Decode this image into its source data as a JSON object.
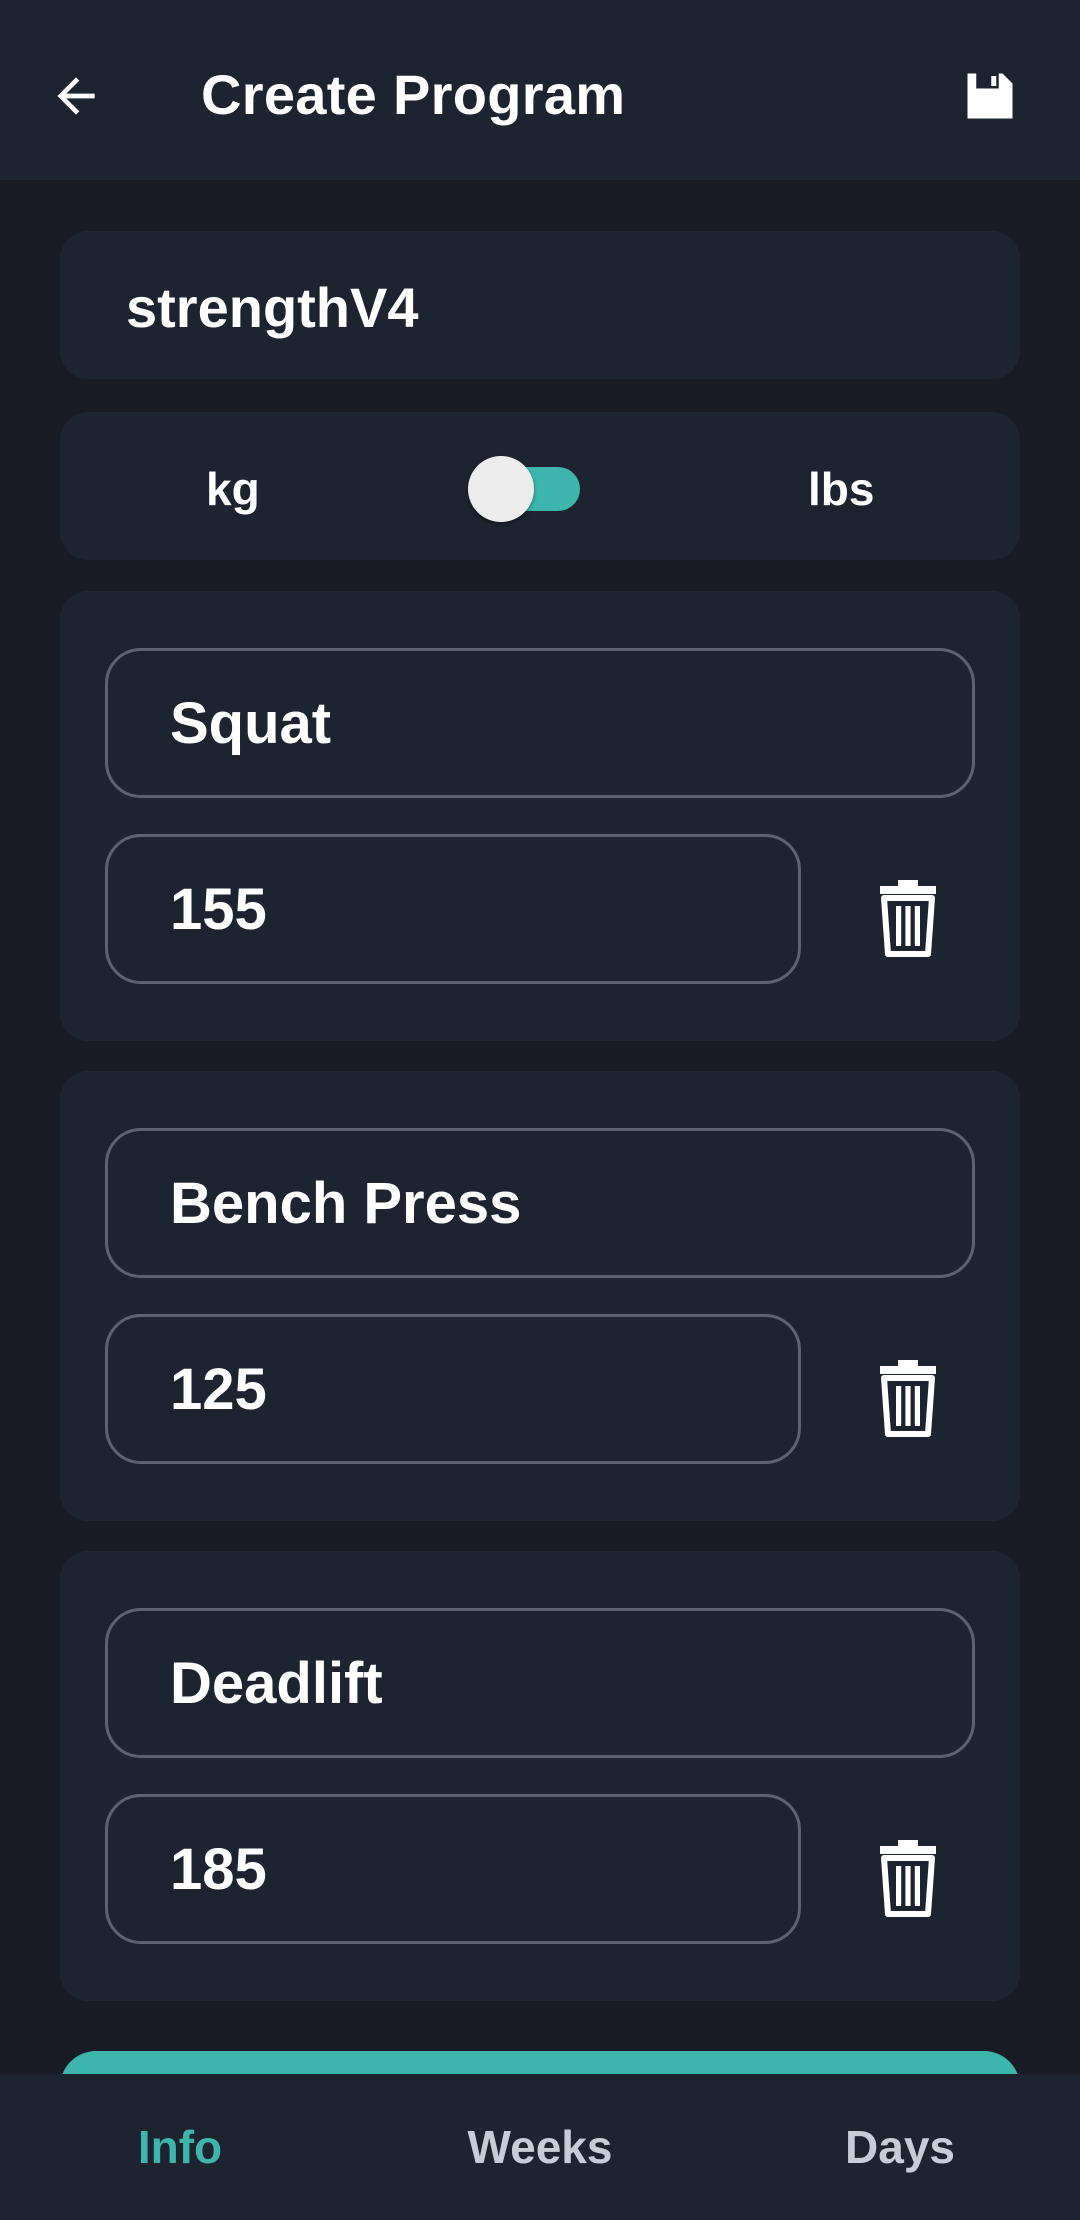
{
  "header": {
    "title": "Create Program",
    "back_icon": "arrow-left-icon",
    "save_icon": "floppy-disk-icon"
  },
  "program": {
    "name": "strengthV4"
  },
  "units": {
    "left_label": "kg",
    "right_label": "lbs",
    "selected": "lbs"
  },
  "lifts": [
    {
      "name": "Squat",
      "weight": "155"
    },
    {
      "name": "Bench Press",
      "weight": "125"
    },
    {
      "name": "Deadlift",
      "weight": "185"
    }
  ],
  "bottom_nav": {
    "items": [
      {
        "label": "Info",
        "active": true
      },
      {
        "label": "Weeks",
        "active": false
      },
      {
        "label": "Days",
        "active": false
      }
    ]
  },
  "colors": {
    "background": "#181b24",
    "surface": "#1e2330",
    "accent": "#3db5ad",
    "border": "#5d6270"
  }
}
